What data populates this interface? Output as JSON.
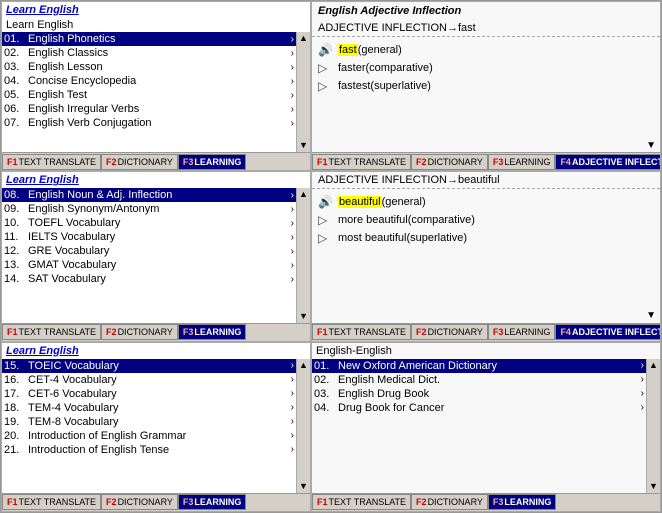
{
  "panels": {
    "top_left": {
      "title": "Learn English",
      "subtitle": "Learn English",
      "items": [
        {
          "num": "01.",
          "text": "English Phonetics",
          "selected": true
        },
        {
          "num": "02.",
          "text": "English Classics",
          "selected": false
        },
        {
          "num": "03.",
          "text": "English Lesson",
          "selected": false
        },
        {
          "num": "04.",
          "text": "Concise Encyclopedia",
          "selected": false
        },
        {
          "num": "05.",
          "text": "English Test",
          "selected": false
        },
        {
          "num": "06.",
          "text": "English Irregular Verbs",
          "selected": false
        },
        {
          "num": "07.",
          "text": "English Verb Conjugation",
          "selected": false
        }
      ],
      "tabs": [
        {
          "key": "F1",
          "label": "TEXT\nTRANSLATE",
          "active": false
        },
        {
          "key": "F2",
          "label": "DICTIONARY",
          "active": false
        },
        {
          "key": "F3",
          "label": "LEARNING",
          "active": true
        },
        {
          "key": "",
          "label": "",
          "active": false
        }
      ]
    },
    "mid_left": {
      "title": "Learn English",
      "items": [
        {
          "num": "08.",
          "text": "English Noun & Adj. Inflection",
          "selected": true
        },
        {
          "num": "09.",
          "text": "English Synonym/Antonym",
          "selected": false
        },
        {
          "num": "10.",
          "text": "TOEFL Vocabulary",
          "selected": false
        },
        {
          "num": "11.",
          "text": "IELTS Vocabulary",
          "selected": false
        },
        {
          "num": "12.",
          "text": "GRE Vocabulary",
          "selected": false
        },
        {
          "num": "13.",
          "text": "GMAT Vocabulary",
          "selected": false
        },
        {
          "num": "14.",
          "text": "SAT Vocabulary",
          "selected": false
        }
      ],
      "tabs": [
        {
          "key": "F1",
          "label": "TEXT TRANSLATE",
          "active": false
        },
        {
          "key": "F2",
          "label": "DICTIONARY",
          "active": false
        },
        {
          "key": "F3",
          "label": "LEARNING",
          "active": true
        },
        {
          "key": "",
          "label": "",
          "active": false
        }
      ]
    },
    "bot_left": {
      "title": "Learn English",
      "items": [
        {
          "num": "15.",
          "text": "TOEIC Vocabulary",
          "selected": true
        },
        {
          "num": "16.",
          "text": "CET-4 Vocabulary",
          "selected": false
        },
        {
          "num": "17.",
          "text": "CET-6 Vocabulary",
          "selected": false
        },
        {
          "num": "18.",
          "text": "TEM-4 Vocabulary",
          "selected": false
        },
        {
          "num": "19.",
          "text": "TEM-8 Vocabulary",
          "selected": false
        },
        {
          "num": "20.",
          "text": "Introduction of English Grammar",
          "selected": false
        },
        {
          "num": "21.",
          "text": "Introduction of English Tense",
          "selected": false
        }
      ],
      "tabs": [
        {
          "key": "F1",
          "label": "TEXT TRANSLATE",
          "active": false
        },
        {
          "key": "F2",
          "label": "DICTIONARY",
          "active": false
        },
        {
          "key": "F3",
          "label": "LEARNING",
          "active": true
        },
        {
          "key": "",
          "label": "",
          "active": false
        }
      ]
    },
    "top_right": {
      "title": "English Adjective Inflection",
      "heading": "ADJECTIVE INFLECTION→fast",
      "highlighted_word": "fast",
      "items": [
        {
          "icon": "🔊",
          "word": "fast",
          "highlight": true,
          "suffix": " (general)"
        },
        {
          "icon": "▷",
          "word": "faster",
          "highlight": false,
          "suffix": " (comparative)"
        },
        {
          "icon": "▷",
          "word": "fastest",
          "highlight": false,
          "suffix": " (superlative)"
        }
      ],
      "tabs": [
        {
          "key": "F1",
          "label": "TEXT TRANSLATE",
          "active": false
        },
        {
          "key": "F2",
          "label": "DICTIONARY",
          "active": false
        },
        {
          "key": "F3",
          "label": "LEARNING",
          "active": false
        },
        {
          "key": "F4",
          "label": "ADJECTIVE INFLECTION",
          "active": true
        }
      ]
    },
    "mid_right": {
      "heading": "ADJECTIVE INFLECTION→beautiful",
      "highlighted_word": "beautiful",
      "items": [
        {
          "icon": "🔊",
          "word": "beautiful",
          "highlight": true,
          "suffix": " (general)"
        },
        {
          "icon": "▷",
          "word": "more beautiful",
          "highlight": false,
          "suffix": " (comparative)"
        },
        {
          "icon": "▷",
          "word": "most beautiful",
          "highlight": false,
          "suffix": " (superlative)"
        }
      ],
      "tabs": [
        {
          "key": "F1",
          "label": "TEXT TRANSLATE",
          "active": false
        },
        {
          "key": "F2",
          "label": "DICTIONARY",
          "active": false
        },
        {
          "key": "F3",
          "label": "LEARNING",
          "active": false
        },
        {
          "key": "F4",
          "label": "ADJECTIVE INFLECTION",
          "active": true
        }
      ]
    },
    "bot_right": {
      "subtitle": "English-English",
      "items": [
        {
          "num": "01.",
          "text": "New Oxford American Dictionary",
          "selected": true
        },
        {
          "num": "02.",
          "text": "English Medical Dict.",
          "selected": false
        },
        {
          "num": "03.",
          "text": "English Drug Book",
          "selected": false
        },
        {
          "num": "04.",
          "text": "Drug Book for Cancer",
          "selected": false
        }
      ],
      "tabs": [
        {
          "key": "F1",
          "label": "TEXT TRANSLATE",
          "active": false
        },
        {
          "key": "F2",
          "label": "DICTIONARY",
          "active": false
        },
        {
          "key": "F3",
          "label": "LEARNING",
          "active": true
        },
        {
          "key": "",
          "label": "",
          "active": false
        }
      ]
    }
  }
}
